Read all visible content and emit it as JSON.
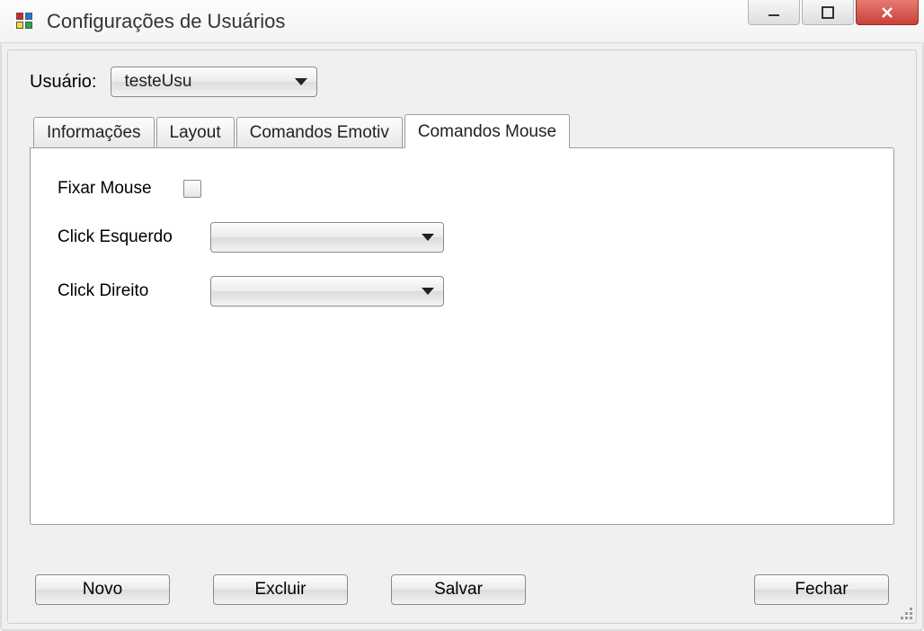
{
  "window": {
    "title": "Configurações de Usuários"
  },
  "user_row": {
    "label": "Usuário:",
    "selected": "testeUsu"
  },
  "tabs": [
    {
      "label": "Informações",
      "active": false
    },
    {
      "label": "Layout",
      "active": false
    },
    {
      "label": "Comandos Emotiv",
      "active": false
    },
    {
      "label": "Comandos Mouse",
      "active": true
    }
  ],
  "mouse_panel": {
    "fix_mouse_label": "Fixar Mouse",
    "fix_mouse_checked": false,
    "left_click_label": "Click Esquerdo",
    "left_click_value": "",
    "right_click_label": "Click Direito",
    "right_click_value": ""
  },
  "buttons": {
    "novo": "Novo",
    "excluir": "Excluir",
    "salvar": "Salvar",
    "fechar": "Fechar"
  }
}
